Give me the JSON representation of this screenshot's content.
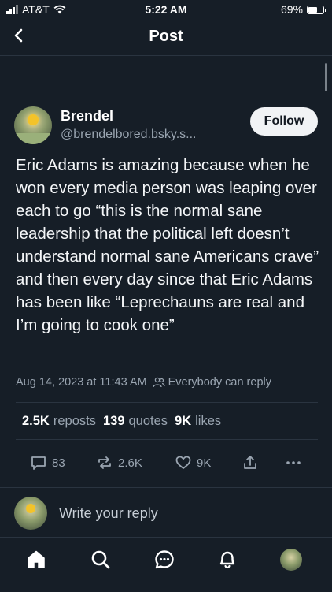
{
  "status_bar": {
    "carrier": "AT&T",
    "time": "5:22 AM",
    "battery": "69%",
    "battery_level": 0.69
  },
  "header": {
    "title": "Post"
  },
  "post": {
    "author": {
      "display_name": "Brendel",
      "handle": "@brendelbored.bsky.s..."
    },
    "follow_label": "Follow",
    "text": "Eric Adams is amazing because when he won every media person was leaping over each to go “this is the normal sane leadership that the political left doesn’t understand normal sane Americans crave” and then every day since that Eric Adams has been like “Leprechauns are real and I’m going to cook one”",
    "timestamp": "Aug 14, 2023 at 11:43 AM",
    "audience": "Everybody can reply",
    "stats": {
      "reposts_count": "2.5K",
      "reposts_label": "reposts",
      "quotes_count": "139",
      "quotes_label": "quotes",
      "likes_count": "9K",
      "likes_label": "likes"
    },
    "actions": {
      "reply_count": "83",
      "repost_count": "2.6K",
      "like_count": "9K"
    }
  },
  "reply_bar": {
    "placeholder": "Write your reply"
  },
  "icons": {
    "back": "chevron-left-icon",
    "home": "home-icon",
    "search": "search-icon",
    "chat": "chat-icon",
    "notifications": "bell-icon",
    "audience": "people-icon",
    "reply": "comment-icon",
    "repost": "repost-icon",
    "like": "heart-icon",
    "share": "share-icon",
    "more": "more-icon"
  },
  "colors": {
    "background": "#161e27",
    "muted_text": "#9aa5b1",
    "follow_button": "#f1f3f5"
  }
}
